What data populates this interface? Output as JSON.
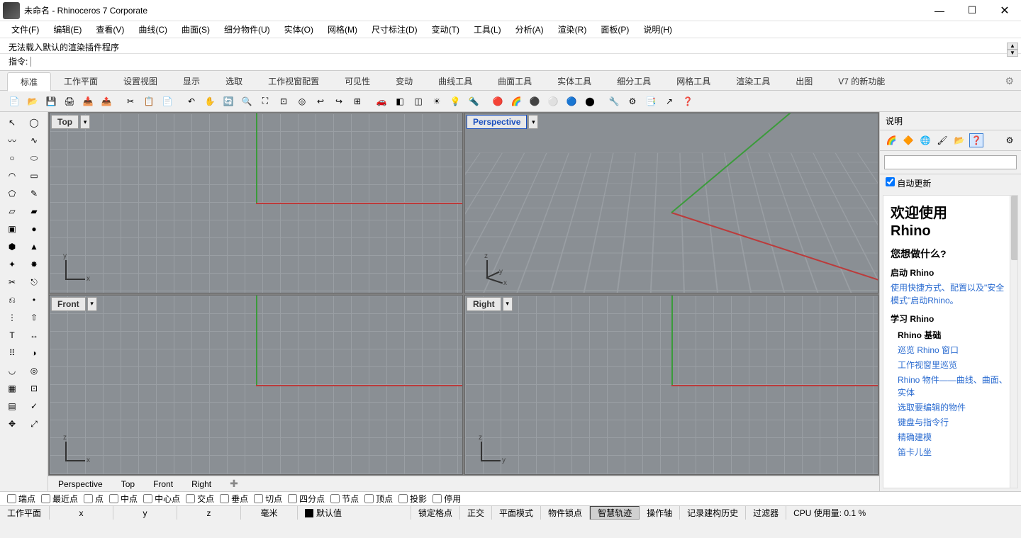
{
  "title": "未命名 - Rhinoceros 7 Corporate",
  "window_controls": {
    "min": "—",
    "max": "☐",
    "close": "✕"
  },
  "menus": [
    "文件(F)",
    "编辑(E)",
    "查看(V)",
    "曲线(C)",
    "曲面(S)",
    "细分物件(U)",
    "实体(O)",
    "网格(M)",
    "尺寸标注(D)",
    "变动(T)",
    "工具(L)",
    "分析(A)",
    "渲染(R)",
    "面板(P)",
    "说明(H)"
  ],
  "message": "无法载入默认的渲染插件程序",
  "command_label": "指令:",
  "command_value": "",
  "tabs": [
    "标准",
    "工作平面",
    "设置视图",
    "显示",
    "选取",
    "工作视窗配置",
    "可见性",
    "变动",
    "曲线工具",
    "曲面工具",
    "实体工具",
    "细分工具",
    "网格工具",
    "渲染工具",
    "出图",
    "V7 的新功能"
  ],
  "active_tab": 0,
  "viewports": {
    "top": "Top",
    "perspective": "Perspective",
    "front": "Front",
    "right": "Right",
    "axis_top": {
      "a1": "y",
      "a2": "x"
    },
    "axis_persp": {
      "a1": "z",
      "a2": "y",
      "a3": "x"
    },
    "axis_front": {
      "a1": "z",
      "a2": "x"
    },
    "axis_right": {
      "a1": "z",
      "a2": "y"
    }
  },
  "view_tabs": [
    "Perspective",
    "Top",
    "Front",
    "Right"
  ],
  "panel": {
    "title": "说明",
    "auto_update_label": "自动更新",
    "auto_update_checked": true,
    "welcome_1": "欢迎使用",
    "welcome_2": "Rhino",
    "what_do": "您想做什么?",
    "start_rhino": "启动 Rhino",
    "start_link": "使用快捷方式、配置以及\"安全模式\"启动Rhino。",
    "learn_rhino": "学习 Rhino",
    "basics": "Rhino 基础",
    "links": [
      "巡览 Rhino 窗口",
      "工作视窗里巡览",
      "Rhino 物件——曲线、曲面、实体",
      "选取要编辑的物件",
      "键盘与指令行",
      "精确建模",
      "笛卡儿坐"
    ]
  },
  "osnaps": [
    "端点",
    "最近点",
    "点",
    "中点",
    "中心点",
    "交点",
    "垂点",
    "切点",
    "四分点",
    "节点",
    "顶点",
    "投影",
    "停用"
  ],
  "status": {
    "plane": "工作平面",
    "x": "x",
    "y": "y",
    "z": "z",
    "unit": "毫米",
    "layer": "默认值",
    "cells": [
      "锁定格点",
      "正交",
      "平面模式",
      "物件锁点",
      "智慧轨迹",
      "操作轴",
      "记录建构历史",
      "过滤器"
    ],
    "cpu": "CPU 使用量: 0.1 %",
    "active_cell": "智慧轨迹"
  }
}
